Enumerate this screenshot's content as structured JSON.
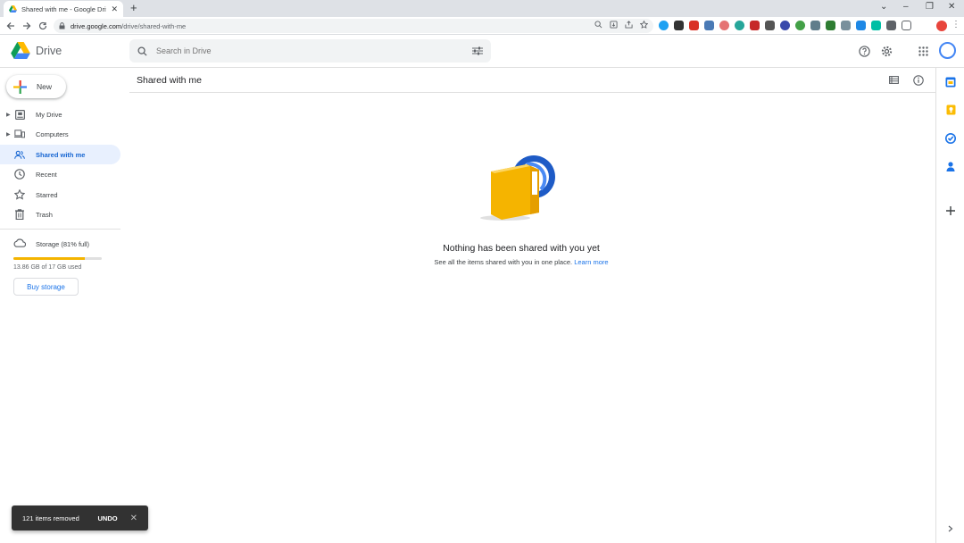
{
  "browser": {
    "tab_title": "Shared with me - Google Drive",
    "new_tab_icon": "plus-icon",
    "url_host": "drive.google.com",
    "url_path": "/drive/shared-with-me"
  },
  "header": {
    "product_name": "Drive",
    "search_placeholder": "Search in Drive"
  },
  "sidebar": {
    "new_label": "New",
    "items": [
      {
        "label": "My Drive",
        "icon": "my-drive-icon",
        "expandable": true
      },
      {
        "label": "Computers",
        "icon": "computers-icon",
        "expandable": true
      },
      {
        "label": "Shared with me",
        "icon": "shared-icon",
        "active": true
      },
      {
        "label": "Recent",
        "icon": "clock-icon"
      },
      {
        "label": "Starred",
        "icon": "star-icon"
      },
      {
        "label": "Trash",
        "icon": "trash-icon"
      }
    ],
    "storage": {
      "label": "Storage (81% full)",
      "used_text": "13.86 GB of 17 GB used",
      "fraction": 0.81,
      "buy_label": "Buy storage"
    }
  },
  "main": {
    "title": "Shared with me",
    "empty_title": "Nothing has been shared with you yet",
    "empty_subtitle": "See all the items shared with you in one place.",
    "learn_more": "Learn more"
  },
  "snackbar": {
    "message": "121 items removed",
    "undo_label": "UNDO"
  },
  "colors": {
    "accent": "#1a73e8",
    "active_bg": "#e8f0fe",
    "storage_fill": "#f4b400"
  }
}
